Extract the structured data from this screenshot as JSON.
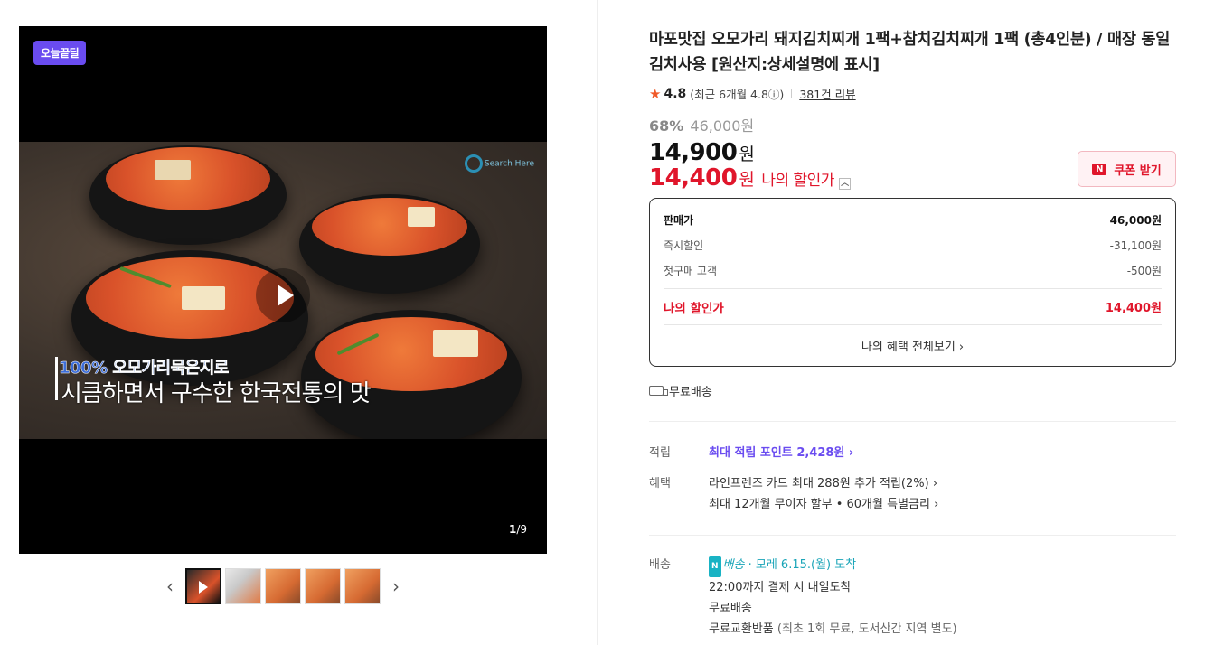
{
  "media": {
    "badge": "오늘끝딜",
    "watermark": "Search Here",
    "overlay_line1": "100% 오모가리묵은지로",
    "overlay_line2": "시큼하면서 구수한 한국전통의 맛",
    "counter_current": "1",
    "counter_total": "/9"
  },
  "product": {
    "title": "마포맛집 오모가리 돼지김치찌개 1팩+참치김치찌개 1팩 (총4인분) / 매장 동일 김치사용 [원산지:상세설명에 표시]",
    "rating": "4.8",
    "rating_recent": "(최근 6개월 4.8ⓘ)",
    "review_link": "381건 리뷰",
    "discount_pct": "68%",
    "original_price": "46,000원",
    "price": "14,900",
    "price_unit": "원",
    "my_price": "14,400",
    "my_price_unit": "원",
    "my_price_label": "나의 할인가",
    "coupon_label": "쿠폰 받기"
  },
  "price_box": {
    "rows": [
      {
        "label": "판매가",
        "amount": "46,000원"
      },
      {
        "label": "즉시할인",
        "amount": "-31,100원"
      },
      {
        "label": "첫구매 고객",
        "amount": "-500원"
      }
    ],
    "mine_label": "나의 할인가",
    "mine_amount": "14,400원",
    "more_link": "나의 혜택 전체보기 ›"
  },
  "shipping_free": "무료배송",
  "points": {
    "label": "적립",
    "text": "최대 적립 포인트 ",
    "amount": "2,428원 ›"
  },
  "benefits": {
    "label": "혜택",
    "line1": "라인프렌즈 카드 최대 288원 추가 적립(2%) ›",
    "line2": "최대 12개월 무이자 할부 • 60개월 특별금리 ›"
  },
  "delivery": {
    "label": "배송",
    "n_badge": "N",
    "n_text": "배송",
    "arrival": " · 모레 6.15.(월) 도착",
    "line2": "22:00까지 결제 시 내일도착",
    "line3": "무료배송",
    "line4_main": "무료교환반품 ",
    "line4_note": "(최초 1회 무료, 도서산간 지역 별도)"
  },
  "colors": {
    "accent_red": "#e0162b",
    "accent_purple": "#6a4cf0",
    "teal": "#1ba5b8"
  }
}
